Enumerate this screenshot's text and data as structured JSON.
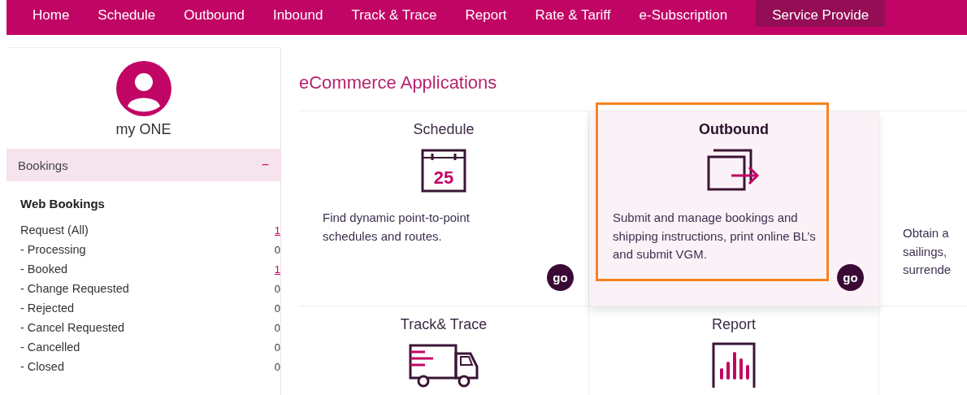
{
  "nav": [
    {
      "label": "Home",
      "selected": false
    },
    {
      "label": "Schedule",
      "selected": false
    },
    {
      "label": "Outbound",
      "selected": false
    },
    {
      "label": "Inbound",
      "selected": false
    },
    {
      "label": "Track & Trace",
      "selected": false
    },
    {
      "label": "Report",
      "selected": false
    },
    {
      "label": "Rate & Tariff",
      "selected": false
    },
    {
      "label": "e-Subscription",
      "selected": false
    },
    {
      "label": "Service Provide",
      "selected": true
    }
  ],
  "sidebar": {
    "user": "my ONE",
    "section": {
      "title": "Bookings",
      "toggle": "−",
      "expanded": true
    },
    "group_title": "Web Bookings",
    "items": [
      {
        "label": "Request (All)",
        "count": "1",
        "kind": "link"
      },
      {
        "label": "- Processing",
        "count": "0",
        "kind": "plain"
      },
      {
        "label": "- Booked",
        "count": "1",
        "kind": "link"
      },
      {
        "label": "- Change Requested",
        "count": "0",
        "kind": "plain"
      },
      {
        "label": "- Rejected",
        "count": "0",
        "kind": "plain"
      },
      {
        "label": "- Cancel Requested",
        "count": "0",
        "kind": "plain"
      },
      {
        "label": "- Cancelled",
        "count": "0",
        "kind": "plain"
      },
      {
        "label": "- Closed",
        "count": "0",
        "kind": "plain"
      }
    ]
  },
  "main": {
    "title": "eCommerce Applications",
    "cards": [
      {
        "title": "Schedule",
        "kind": "calendar",
        "icon_text": "25",
        "description": [
          "Find dynamic point-to-point",
          "schedules and routes."
        ],
        "button": "go",
        "selected": false
      },
      {
        "title": "Outbound",
        "kind": "export",
        "description": [
          "Submit and manage bookings and",
          "shipping instructions, print online BL’s",
          "and submit VGM."
        ],
        "button": "go",
        "selected": true
      },
      {
        "description": [
          "Obtain a",
          "sailings,",
          "surrende"
        ],
        "selected": false
      },
      {
        "title": "Track& Trace",
        "kind": "truck",
        "selected": false
      },
      {
        "title": "Report",
        "kind": "chart",
        "selected": false
      }
    ]
  }
}
